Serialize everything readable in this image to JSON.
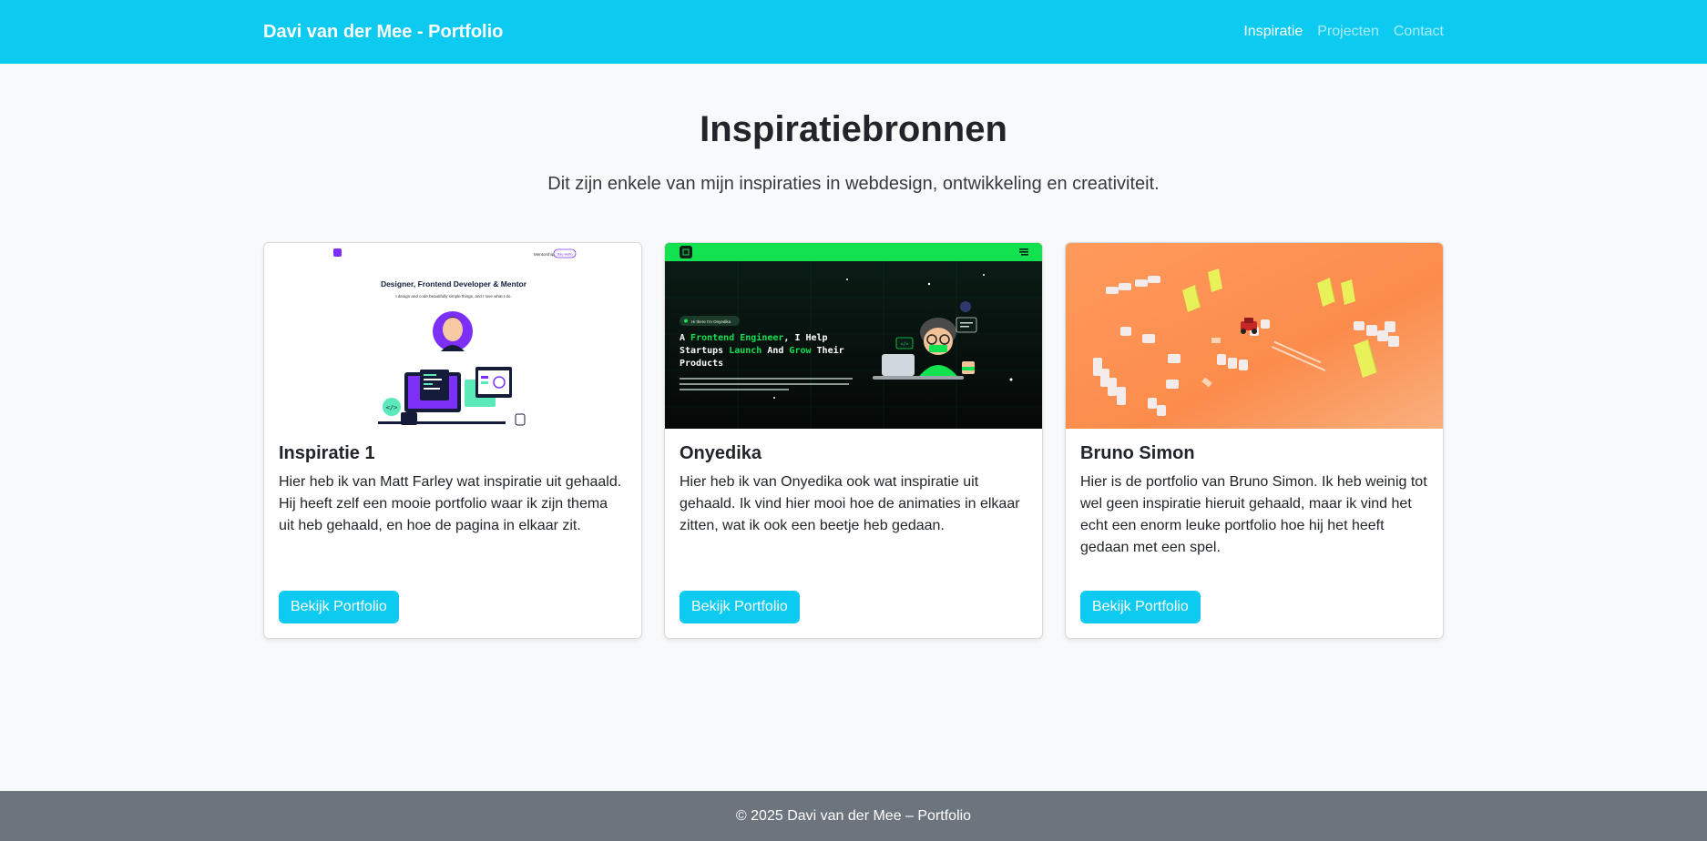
{
  "nav": {
    "brand": "Davi van der Mee - Portfolio",
    "links": [
      {
        "label": "Inspiratie",
        "active": true
      },
      {
        "label": "Projecten",
        "active": false
      },
      {
        "label": "Contact",
        "active": false
      }
    ]
  },
  "header": {
    "title": "Inspiratiebronnen",
    "subtitle": "Dit zijn enkele van mijn inspiraties in webdesign, ontwikkeling en creativiteit."
  },
  "cards": [
    {
      "title": "Inspiratie 1",
      "text": "Hier heb ik van Matt Farley wat inspiratie uit gehaald. Hij heeft zelf een mooie portfolio waar ik zijn thema uit heb gehaald, en hoe de pagina in elkaar zit.",
      "button": "Bekijk Portfolio",
      "thumb": {
        "nav_text": "Mentorship",
        "badge": "Say Hello",
        "headline": "Designer, Frontend Developer & Mentor",
        "sub": "I design and code beautifully simple things, and I love what I do."
      }
    },
    {
      "title": "Onyedika",
      "text": "Hier heb ik van Onyedika ook wat inspiratie uit gehaald. Ik vind hier mooi hoe de animaties in elkaar zitten, wat ik ook een beetje heb gedaan.",
      "button": "Bekijk Portfolio",
      "thumb": {
        "pill": "Hi there I'm Onyedika",
        "line1a": "A ",
        "line1b": "Frontend Engineer",
        "line1c": ", I Help",
        "line2a": "Startups ",
        "line2b": "Launch",
        "line2c": " And ",
        "line2d": "Grow",
        "line2e": " Their",
        "line3": "Products"
      }
    },
    {
      "title": "Bruno Simon",
      "text": "Hier is de portfolio van Bruno Simon. Ik heb weinig tot wel geen inspiratie hieruit gehaald, maar ik vind het echt een enorm leuke portfolio hoe hij het heeft gedaan met een spel.",
      "button": "Bekijk Portfolio"
    }
  ],
  "footer": {
    "text": "© 2025 Davi van der Mee – Portfolio"
  },
  "colors": {
    "primary": "#0dcaf0",
    "footer": "#6c757d",
    "background": "#f8f9fa",
    "onyedika_green": "#12e150",
    "bruno_orange": "#fb8c4c"
  }
}
